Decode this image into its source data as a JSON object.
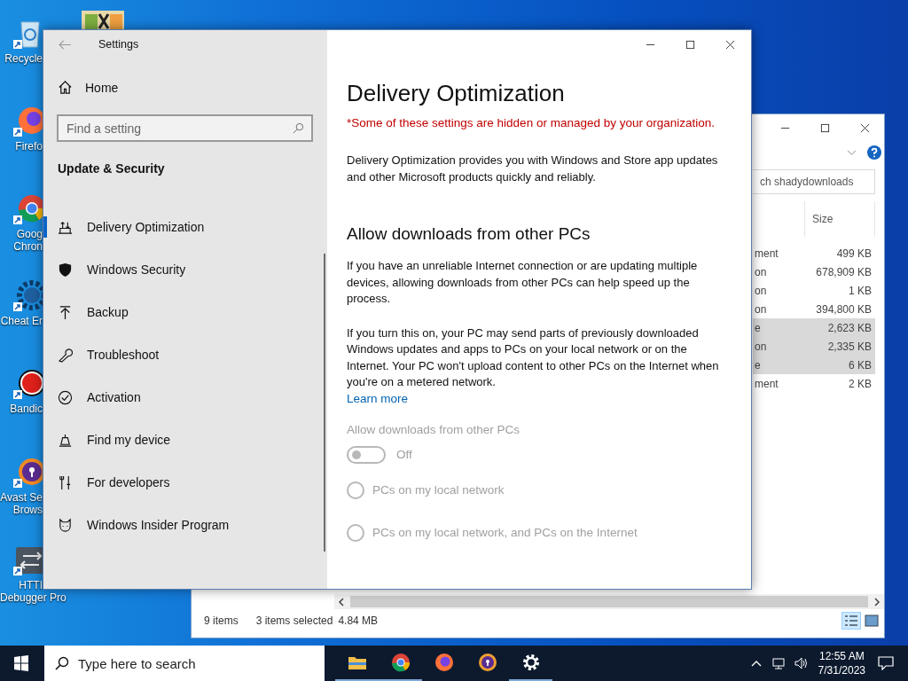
{
  "desktop_icons": [
    {
      "kind": "recycle",
      "lines": [
        "Recycle"
      ]
    },
    {
      "kind": "firefox",
      "lines": [
        "Firefo"
      ]
    },
    {
      "kind": "chrome",
      "lines": [
        "Goog",
        "Chron"
      ]
    },
    {
      "kind": "gear",
      "lines": [
        "Cheat Er"
      ]
    },
    {
      "kind": "record",
      "lines": [
        "Bandic"
      ]
    },
    {
      "kind": "avast",
      "lines": [
        "Avast Se",
        "Brows"
      ]
    },
    {
      "kind": "arrows",
      "lines": [
        "HTTI",
        "Debugger Pro"
      ]
    }
  ],
  "explorer": {
    "search_text": "ch shadydownloads",
    "column": "Size",
    "rows": [
      {
        "type": "ment",
        "size": "499 KB",
        "selected": false
      },
      {
        "type": "on",
        "size": "678,909 KB",
        "selected": false
      },
      {
        "type": "on",
        "size": "1 KB",
        "selected": false
      },
      {
        "type": "on",
        "size": "394,800 KB",
        "selected": false
      },
      {
        "type": "e",
        "size": "2,623 KB",
        "selected": true
      },
      {
        "type": "on",
        "size": "2,335 KB",
        "selected": true
      },
      {
        "type": "e",
        "size": "6 KB",
        "selected": true
      },
      {
        "type": "ment",
        "size": "2 KB",
        "selected": false
      }
    ],
    "status": {
      "items": "9 items",
      "selection": "3 items selected",
      "selection_size": "4.84 MB"
    }
  },
  "settings": {
    "title": "Settings",
    "home": "Home",
    "search": {
      "placeholder": "Find a setting"
    },
    "section": "Update & Security",
    "nav": [
      {
        "kind": "delivery",
        "label": "Delivery Optimization",
        "selected": true
      },
      {
        "kind": "shield",
        "label": "Windows Security",
        "selected": false
      },
      {
        "kind": "backup",
        "label": "Backup",
        "selected": false
      },
      {
        "kind": "wrench",
        "label": "Troubleshoot",
        "selected": false
      },
      {
        "kind": "check",
        "label": "Activation",
        "selected": false
      },
      {
        "kind": "person",
        "label": "Find my device",
        "selected": false
      },
      {
        "kind": "tools",
        "label": "For developers",
        "selected": false
      },
      {
        "kind": "cat",
        "label": "Windows Insider Program",
        "selected": false
      }
    ],
    "heading": "Delivery Optimization",
    "managed_note": "*Some of these settings are hidden or managed by your organization.",
    "intro": "Delivery Optimization provides you with Windows and Store app updates and other Microsoft products quickly and reliably.",
    "section_title": "Allow downloads from other PCs",
    "paragraphs": [
      "If you have an unreliable Internet connection or are updating multiple devices, allowing downloads from other PCs can help speed up the process.",
      "If you turn this on, your PC may send parts of previously downloaded Windows updates and apps to PCs on your local network or on the Internet. Your PC won't upload content to other PCs on the Internet when you're on a metered network."
    ],
    "link": "Learn more",
    "toggle": {
      "label": "Allow downloads from other PCs",
      "on": false,
      "state_text": "Off",
      "disabled": true
    },
    "radios": [
      {
        "label": "PCs on my local network",
        "selected": false,
        "disabled": true
      },
      {
        "label": "PCs on my local network, and PCs on the Internet",
        "selected": false,
        "disabled": true
      }
    ]
  },
  "taskbar": {
    "search": {
      "placeholder": "Type here to search"
    },
    "apps": [
      {
        "kind": "folder",
        "running": true
      },
      {
        "kind": "chrome",
        "running": true
      },
      {
        "kind": "firefox",
        "running": false
      },
      {
        "kind": "avast",
        "running": false
      },
      {
        "kind": "gear",
        "running": true
      }
    ],
    "time": "12:55 AM",
    "date": "7/31/2023"
  }
}
